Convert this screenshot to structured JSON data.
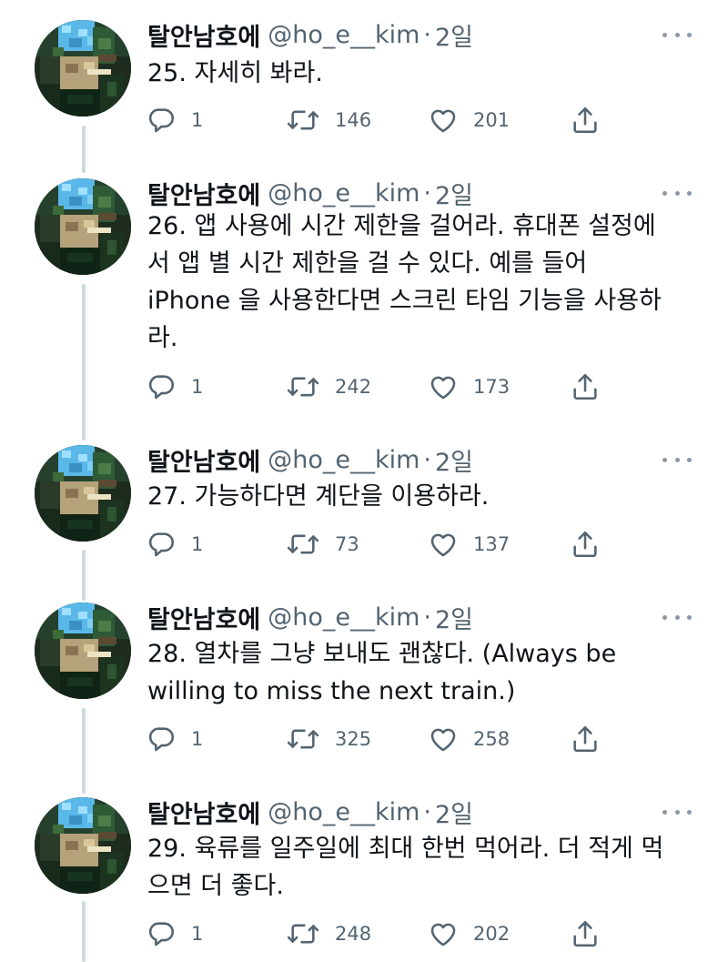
{
  "colors": {
    "text": "#0f1419",
    "secondary": "#536471",
    "thread_line": "#cfd9de",
    "icon": "#536471"
  },
  "tweets": [
    {
      "display_name": "탈안남호에",
      "handle": "@ho_e__kim",
      "separator": "·",
      "time": "2일",
      "text": "25. 자세히 봐라.",
      "replies": "1",
      "retweets": "146",
      "likes": "201"
    },
    {
      "display_name": "탈안남호에",
      "handle": "@ho_e__kim",
      "separator": "·",
      "time": "2일",
      "text": "26. 앱 사용에 시간 제한을 걸어라. 휴대폰 설정에\n서 앱 별 시간 제한을 걸 수 있다. 예를 들어\niPhone 을 사용한다면 스크린 타임 기능을 사용하\n라.",
      "replies": "1",
      "retweets": "242",
      "likes": "173"
    },
    {
      "display_name": "탈안남호에",
      "handle": "@ho_e__kim",
      "separator": "·",
      "time": "2일",
      "text": "27. 가능하다면 계단을 이용하라.",
      "replies": "1",
      "retweets": "73",
      "likes": "137"
    },
    {
      "display_name": "탈안남호에",
      "handle": "@ho_e__kim",
      "separator": "·",
      "time": "2일",
      "text": "28. 열차를 그냥 보내도 괜찮다. (Always be\nwilling to miss the next train.)",
      "replies": "1",
      "retweets": "325",
      "likes": "258"
    },
    {
      "display_name": "탈안남호에",
      "handle": "@ho_e__kim",
      "separator": "·",
      "time": "2일",
      "text": "29. 육류를 일주일에 최대 한번 먹어라. 더 적게 먹\n으면 더 좋다.",
      "replies": "1",
      "retweets": "248",
      "likes": "202"
    }
  ],
  "icons": {
    "reply": "reply-icon",
    "retweet": "retweet-icon",
    "like": "heart-icon",
    "share": "share-icon",
    "more": "more-icon"
  }
}
